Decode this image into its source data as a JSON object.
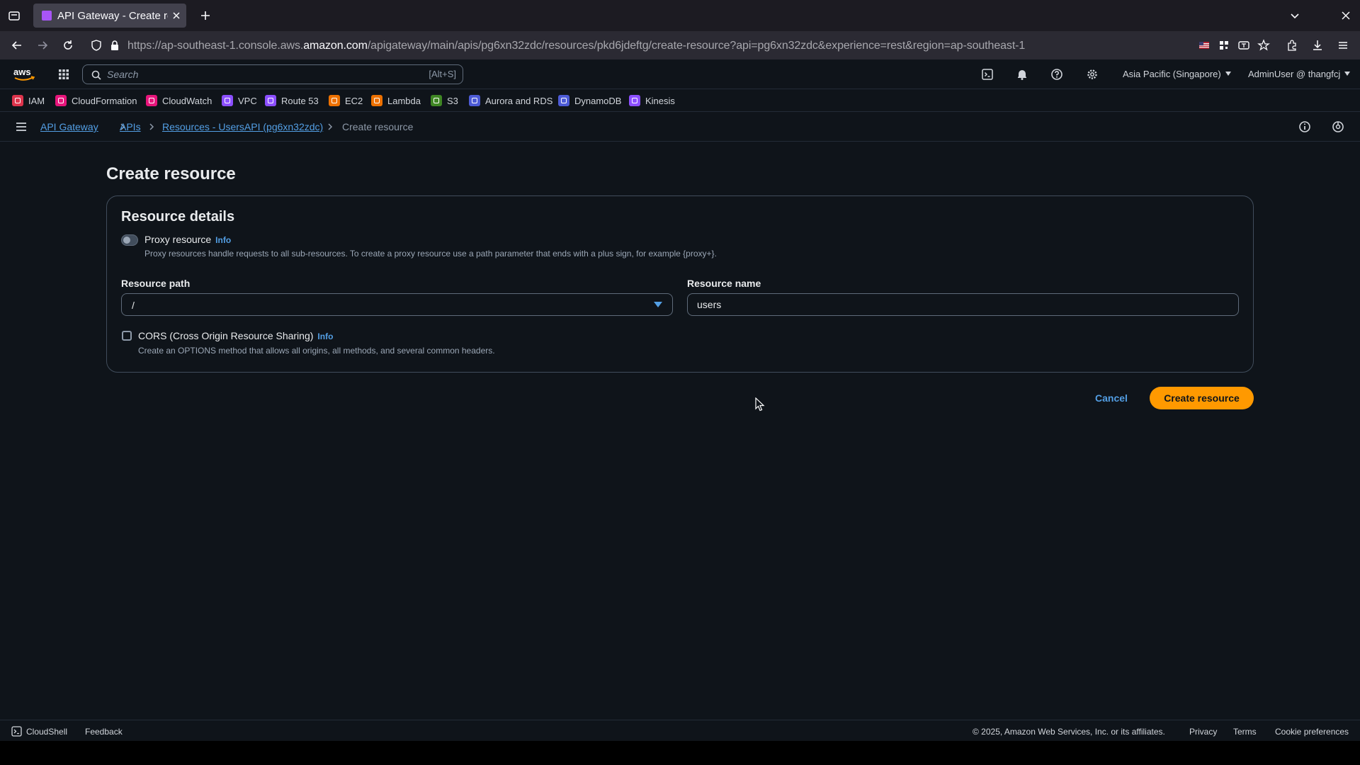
{
  "browser": {
    "tab_title": "API Gateway - Create resource",
    "url_prefix": "https://ap-southeast-1.console.aws.",
    "url_domain": "amazon.com",
    "url_path": "/apigateway/main/apis/pg6xn32zdc/resources/pkd6jdeftg/create-resource?api=pg6xn32zdc&experience=rest&region=ap-southeast-1"
  },
  "aws_nav": {
    "search_placeholder": "Search",
    "search_shortcut": "[Alt+S]",
    "region": "Asia Pacific (Singapore)",
    "user": "AdminUser @ thangfcj"
  },
  "favorites": [
    {
      "label": "IAM",
      "color": "#dd344c"
    },
    {
      "label": "CloudFormation",
      "color": "#e7157b"
    },
    {
      "label": "CloudWatch",
      "color": "#e7157b"
    },
    {
      "label": "VPC",
      "color": "#8c4fff"
    },
    {
      "label": "Route 53",
      "color": "#8c4fff"
    },
    {
      "label": "EC2",
      "color": "#ed7100"
    },
    {
      "label": "Lambda",
      "color": "#ed7100"
    },
    {
      "label": "S3",
      "color": "#3f8624"
    },
    {
      "label": "Aurora and RDS",
      "color": "#4d5bd6"
    },
    {
      "label": "DynamoDB",
      "color": "#4d5bd6"
    },
    {
      "label": "Kinesis",
      "color": "#8c4fff"
    }
  ],
  "breadcrumbs": {
    "items": [
      "API Gateway",
      "APIs",
      "Resources - UsersAPI (pg6xn32zdc)"
    ],
    "current": "Create resource"
  },
  "page": {
    "title": "Create resource",
    "section_title": "Resource details",
    "proxy_label": "Proxy resource",
    "info_label": "Info",
    "proxy_desc": "Proxy resources handle requests to all sub-resources. To create a proxy resource use a path parameter that ends with a plus sign, for example {proxy+}.",
    "path_label": "Resource path",
    "path_value": "/",
    "name_label": "Resource name",
    "name_value": "users",
    "cors_label": "CORS (Cross Origin Resource Sharing)",
    "cors_desc": "Create an OPTIONS method that allows all origins, all methods, and several common headers.",
    "cancel_label": "Cancel",
    "create_label": "Create resource"
  },
  "footer": {
    "cloudshell": "CloudShell",
    "feedback": "Feedback",
    "copyright": "© 2025, Amazon Web Services, Inc. or its affiliates.",
    "privacy": "Privacy",
    "terms": "Terms",
    "cookie": "Cookie preferences"
  },
  "colors": {
    "accent": "#ff9900",
    "link": "#539fe5",
    "background": "#0f141a"
  }
}
